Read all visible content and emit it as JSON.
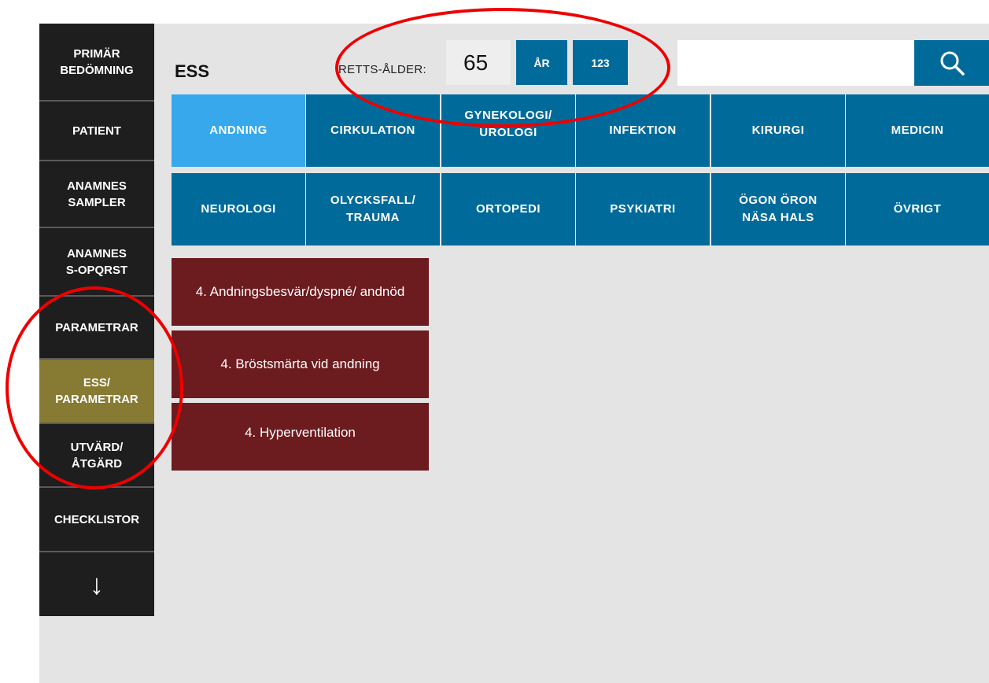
{
  "sidebar": {
    "items": [
      {
        "label": "PRIMÄR\nBEDÖMNING"
      },
      {
        "label": "PATIENT"
      },
      {
        "label": "ANAMNES\nSAMPLER"
      },
      {
        "label": "ANAMNES\nS-OPQRST"
      },
      {
        "label": "PARAMETRAR"
      },
      {
        "label": "ESS/\nPARAMETRAR"
      },
      {
        "label": "UTVÄRD/\nÅTGÄRD"
      },
      {
        "label": "CHECKLISTOR"
      }
    ],
    "scroll_glyph": "↓",
    "active_color": "#877a33"
  },
  "header": {
    "title": "ESS",
    "age_label": "RETTS-ÅLDER:",
    "age_value": "65",
    "years_button": "ÅR",
    "numpad_button": "123",
    "search_value": "",
    "search_icon": "search-icon"
  },
  "categories": [
    {
      "label": "ANDNING"
    },
    {
      "label": "CIRKULATION"
    },
    {
      "label": "GYNEKOLOGI/\nUROLOGI"
    },
    {
      "label": "INFEKTION"
    },
    {
      "label": "KIRURGI"
    },
    {
      "label": "MEDICIN"
    },
    {
      "label": "NEUROLOGI"
    },
    {
      "label": "OLYCKSFALL/\nTRAUMA"
    },
    {
      "label": "ORTOPEDI"
    },
    {
      "label": "PSYKIATRI"
    },
    {
      "label": "ÖGON ÖRON\nNÄSA HALS"
    },
    {
      "label": "ÖVRIGT"
    }
  ],
  "symptoms": [
    {
      "label": "4. Andningsbesvär/dyspné/ andnöd"
    },
    {
      "label": "4. Bröstsmärta vid andning"
    },
    {
      "label": "4. Hyperventilation"
    }
  ],
  "colors": {
    "category_blue": "#006b9a",
    "category_active": "#36a8eb",
    "symptom_red": "#6c1b1f",
    "annotation_red": "#ee0000"
  }
}
